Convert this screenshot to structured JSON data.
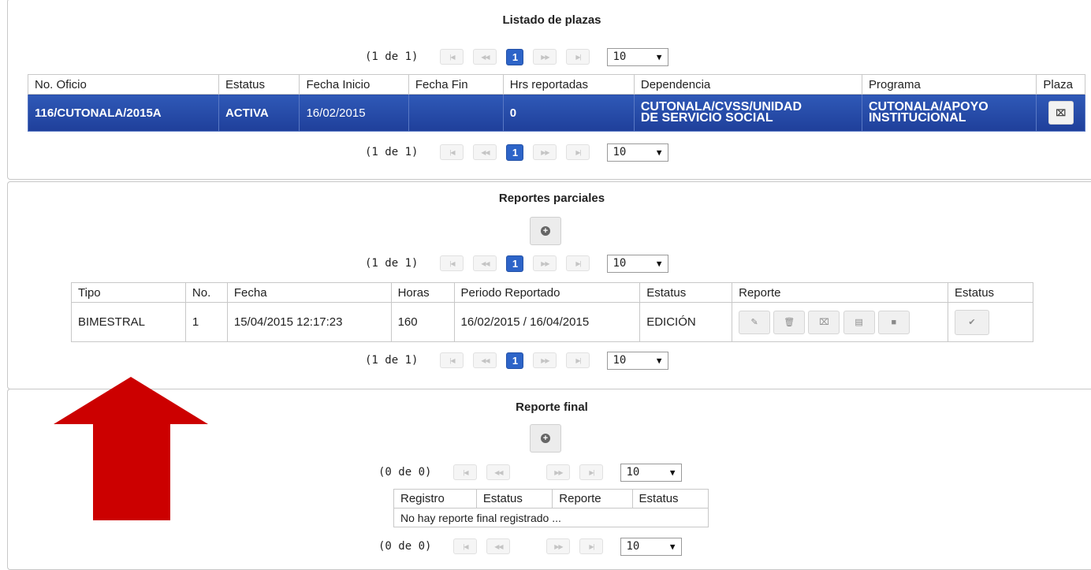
{
  "colors": {
    "selected_row": "#2f59b7",
    "page_active": "#2d64c8",
    "arrow": "#cc0000"
  },
  "plazas": {
    "title": "Listado de plazas",
    "count": "(1 de 1)",
    "page": "1",
    "rows_per_page": "10",
    "headers": [
      "No. Oficio",
      "Estatus",
      "Fecha Inicio",
      "Fecha Fin",
      "Hrs reportadas",
      "Dependencia",
      "Programa",
      "Plaza"
    ],
    "row": {
      "oficio": "116/CUTONALA/2015A",
      "estatus": "ACTIVA",
      "fecha_inicio": "16/02/2015",
      "fecha_fin": "",
      "hrs": "0",
      "dependencia_1": "CUTONALA/CVSS/UNIDAD",
      "dependencia_2": "DE SERVICIO SOCIAL",
      "programa_1": "CUTONALA/APOYO",
      "programa_2": "INSTITUCIONAL"
    }
  },
  "parciales": {
    "title": "Reportes parciales",
    "count": "(1 de 1)",
    "page": "1",
    "rows_per_page": "10",
    "headers": [
      "Tipo",
      "No.",
      "Fecha",
      "Horas",
      "Periodo Reportado",
      "Estatus",
      "Reporte",
      "Estatus"
    ],
    "row": {
      "tipo": "BIMESTRAL",
      "no": "1",
      "fecha": "15/04/2015 12:17:23",
      "horas": "160",
      "periodo": "16/02/2015 / 16/04/2015",
      "estatus": "EDICIÓN"
    }
  },
  "final": {
    "title": "Reporte final",
    "count": "(0 de 0)",
    "rows_per_page": "10",
    "headers": [
      "Registro",
      "Estatus",
      "Reporte",
      "Estatus"
    ],
    "empty": "No hay reporte final registrado ..."
  }
}
